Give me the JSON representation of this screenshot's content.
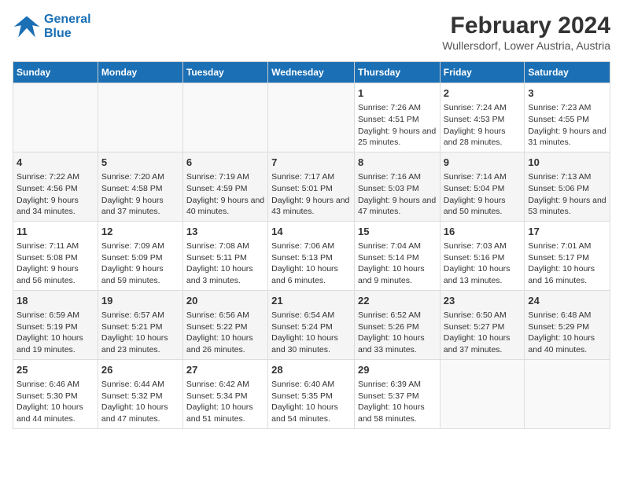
{
  "logo": {
    "line1": "General",
    "line2": "Blue"
  },
  "title": "February 2024",
  "subtitle": "Wullersdorf, Lower Austria, Austria",
  "headers": [
    "Sunday",
    "Monday",
    "Tuesday",
    "Wednesday",
    "Thursday",
    "Friday",
    "Saturday"
  ],
  "weeks": [
    [
      {
        "day": "",
        "info": ""
      },
      {
        "day": "",
        "info": ""
      },
      {
        "day": "",
        "info": ""
      },
      {
        "day": "",
        "info": ""
      },
      {
        "day": "1",
        "info": "Sunrise: 7:26 AM\nSunset: 4:51 PM\nDaylight: 9 hours and 25 minutes."
      },
      {
        "day": "2",
        "info": "Sunrise: 7:24 AM\nSunset: 4:53 PM\nDaylight: 9 hours and 28 minutes."
      },
      {
        "day": "3",
        "info": "Sunrise: 7:23 AM\nSunset: 4:55 PM\nDaylight: 9 hours and 31 minutes."
      }
    ],
    [
      {
        "day": "4",
        "info": "Sunrise: 7:22 AM\nSunset: 4:56 PM\nDaylight: 9 hours and 34 minutes."
      },
      {
        "day": "5",
        "info": "Sunrise: 7:20 AM\nSunset: 4:58 PM\nDaylight: 9 hours and 37 minutes."
      },
      {
        "day": "6",
        "info": "Sunrise: 7:19 AM\nSunset: 4:59 PM\nDaylight: 9 hours and 40 minutes."
      },
      {
        "day": "7",
        "info": "Sunrise: 7:17 AM\nSunset: 5:01 PM\nDaylight: 9 hours and 43 minutes."
      },
      {
        "day": "8",
        "info": "Sunrise: 7:16 AM\nSunset: 5:03 PM\nDaylight: 9 hours and 47 minutes."
      },
      {
        "day": "9",
        "info": "Sunrise: 7:14 AM\nSunset: 5:04 PM\nDaylight: 9 hours and 50 minutes."
      },
      {
        "day": "10",
        "info": "Sunrise: 7:13 AM\nSunset: 5:06 PM\nDaylight: 9 hours and 53 minutes."
      }
    ],
    [
      {
        "day": "11",
        "info": "Sunrise: 7:11 AM\nSunset: 5:08 PM\nDaylight: 9 hours and 56 minutes."
      },
      {
        "day": "12",
        "info": "Sunrise: 7:09 AM\nSunset: 5:09 PM\nDaylight: 9 hours and 59 minutes."
      },
      {
        "day": "13",
        "info": "Sunrise: 7:08 AM\nSunset: 5:11 PM\nDaylight: 10 hours and 3 minutes."
      },
      {
        "day": "14",
        "info": "Sunrise: 7:06 AM\nSunset: 5:13 PM\nDaylight: 10 hours and 6 minutes."
      },
      {
        "day": "15",
        "info": "Sunrise: 7:04 AM\nSunset: 5:14 PM\nDaylight: 10 hours and 9 minutes."
      },
      {
        "day": "16",
        "info": "Sunrise: 7:03 AM\nSunset: 5:16 PM\nDaylight: 10 hours and 13 minutes."
      },
      {
        "day": "17",
        "info": "Sunrise: 7:01 AM\nSunset: 5:17 PM\nDaylight: 10 hours and 16 minutes."
      }
    ],
    [
      {
        "day": "18",
        "info": "Sunrise: 6:59 AM\nSunset: 5:19 PM\nDaylight: 10 hours and 19 minutes."
      },
      {
        "day": "19",
        "info": "Sunrise: 6:57 AM\nSunset: 5:21 PM\nDaylight: 10 hours and 23 minutes."
      },
      {
        "day": "20",
        "info": "Sunrise: 6:56 AM\nSunset: 5:22 PM\nDaylight: 10 hours and 26 minutes."
      },
      {
        "day": "21",
        "info": "Sunrise: 6:54 AM\nSunset: 5:24 PM\nDaylight: 10 hours and 30 minutes."
      },
      {
        "day": "22",
        "info": "Sunrise: 6:52 AM\nSunset: 5:26 PM\nDaylight: 10 hours and 33 minutes."
      },
      {
        "day": "23",
        "info": "Sunrise: 6:50 AM\nSunset: 5:27 PM\nDaylight: 10 hours and 37 minutes."
      },
      {
        "day": "24",
        "info": "Sunrise: 6:48 AM\nSunset: 5:29 PM\nDaylight: 10 hours and 40 minutes."
      }
    ],
    [
      {
        "day": "25",
        "info": "Sunrise: 6:46 AM\nSunset: 5:30 PM\nDaylight: 10 hours and 44 minutes."
      },
      {
        "day": "26",
        "info": "Sunrise: 6:44 AM\nSunset: 5:32 PM\nDaylight: 10 hours and 47 minutes."
      },
      {
        "day": "27",
        "info": "Sunrise: 6:42 AM\nSunset: 5:34 PM\nDaylight: 10 hours and 51 minutes."
      },
      {
        "day": "28",
        "info": "Sunrise: 6:40 AM\nSunset: 5:35 PM\nDaylight: 10 hours and 54 minutes."
      },
      {
        "day": "29",
        "info": "Sunrise: 6:39 AM\nSunset: 5:37 PM\nDaylight: 10 hours and 58 minutes."
      },
      {
        "day": "",
        "info": ""
      },
      {
        "day": "",
        "info": ""
      }
    ]
  ]
}
